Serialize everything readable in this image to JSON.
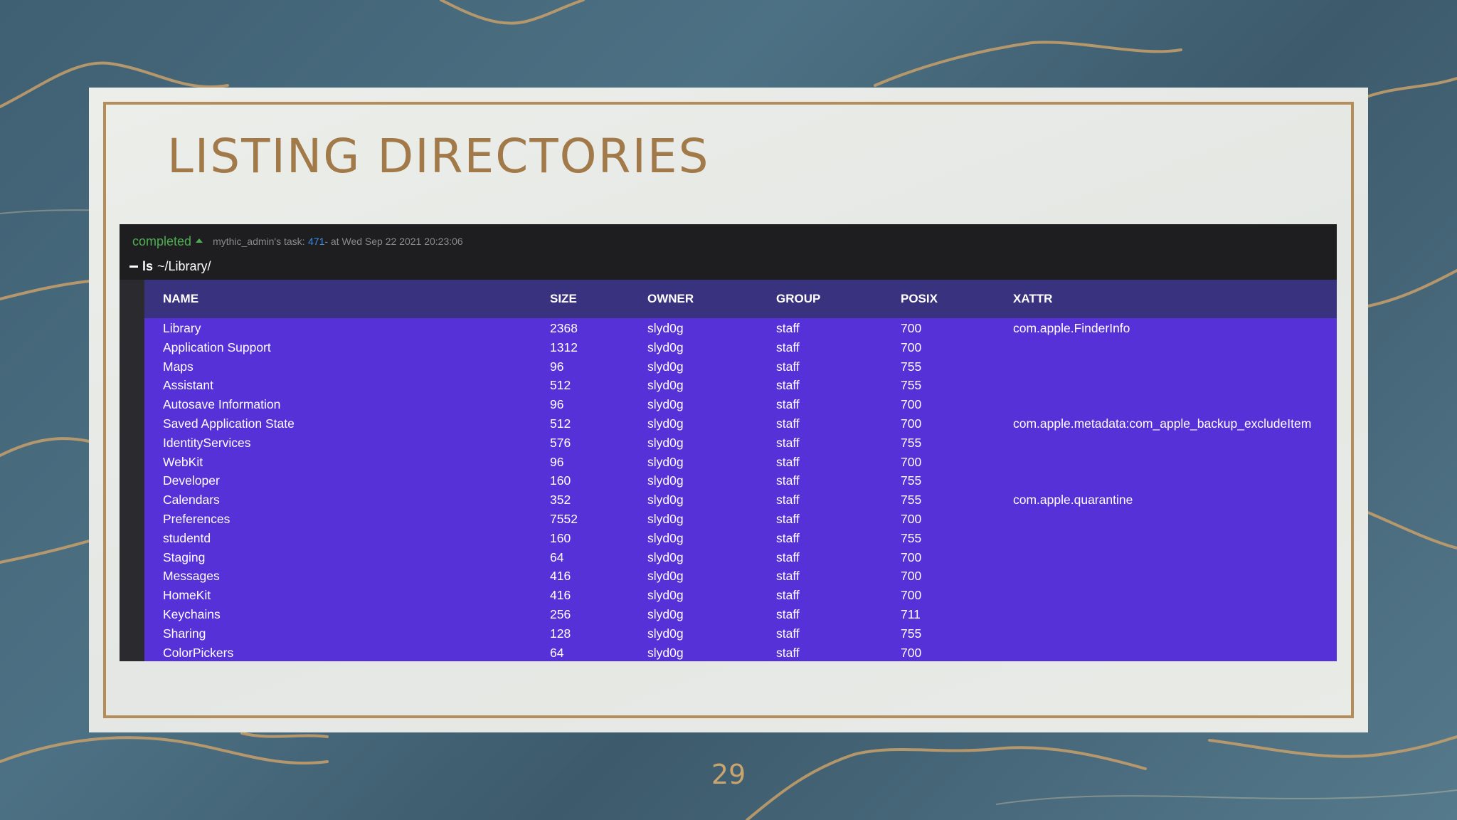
{
  "slide": {
    "title": "LISTING DIRECTORIES",
    "page_number": "29"
  },
  "task": {
    "status": "completed",
    "meta_prefix": "mythic_admin's task: ",
    "id": "471",
    "meta_suffix": " - at Wed Sep 22 2021 20:23:06",
    "status_color": "#4caf50",
    "id_color": "#3b8fe6"
  },
  "command": {
    "name": "ls",
    "args": "~/Library/"
  },
  "table": {
    "columns": [
      "NAME",
      "SIZE",
      "OWNER",
      "GROUP",
      "POSIX",
      "XATTR"
    ],
    "rows": [
      [
        "Library",
        "2368",
        "slyd0g",
        "staff",
        "700",
        "com.apple.FinderInfo"
      ],
      [
        "Application Support",
        "1312",
        "slyd0g",
        "staff",
        "700",
        ""
      ],
      [
        "Maps",
        "96",
        "slyd0g",
        "staff",
        "755",
        ""
      ],
      [
        "Assistant",
        "512",
        "slyd0g",
        "staff",
        "755",
        ""
      ],
      [
        "Autosave Information",
        "96",
        "slyd0g",
        "staff",
        "700",
        ""
      ],
      [
        "Saved Application State",
        "512",
        "slyd0g",
        "staff",
        "700",
        "com.apple.metadata:com_apple_backup_excludeItem"
      ],
      [
        "IdentityServices",
        "576",
        "slyd0g",
        "staff",
        "755",
        ""
      ],
      [
        "WebKit",
        "96",
        "slyd0g",
        "staff",
        "700",
        ""
      ],
      [
        "Developer",
        "160",
        "slyd0g",
        "staff",
        "755",
        ""
      ],
      [
        "Calendars",
        "352",
        "slyd0g",
        "staff",
        "755",
        "com.apple.quarantine"
      ],
      [
        "Preferences",
        "7552",
        "slyd0g",
        "staff",
        "700",
        ""
      ],
      [
        "studentd",
        "160",
        "slyd0g",
        "staff",
        "755",
        ""
      ],
      [
        "Staging",
        "64",
        "slyd0g",
        "staff",
        "700",
        ""
      ],
      [
        "Messages",
        "416",
        "slyd0g",
        "staff",
        "700",
        ""
      ],
      [
        "HomeKit",
        "416",
        "slyd0g",
        "staff",
        "700",
        ""
      ],
      [
        "Keychains",
        "256",
        "slyd0g",
        "staff",
        "711",
        ""
      ],
      [
        "Sharing",
        "128",
        "slyd0g",
        "staff",
        "755",
        ""
      ],
      [
        "ColorPickers",
        "64",
        "slyd0g",
        "staff",
        "700",
        ""
      ]
    ],
    "header_color": "#39327f",
    "body_color": "#5631d8"
  },
  "theme": {
    "title_color": "#a27a4a",
    "frame_color": "#b58d5a"
  }
}
